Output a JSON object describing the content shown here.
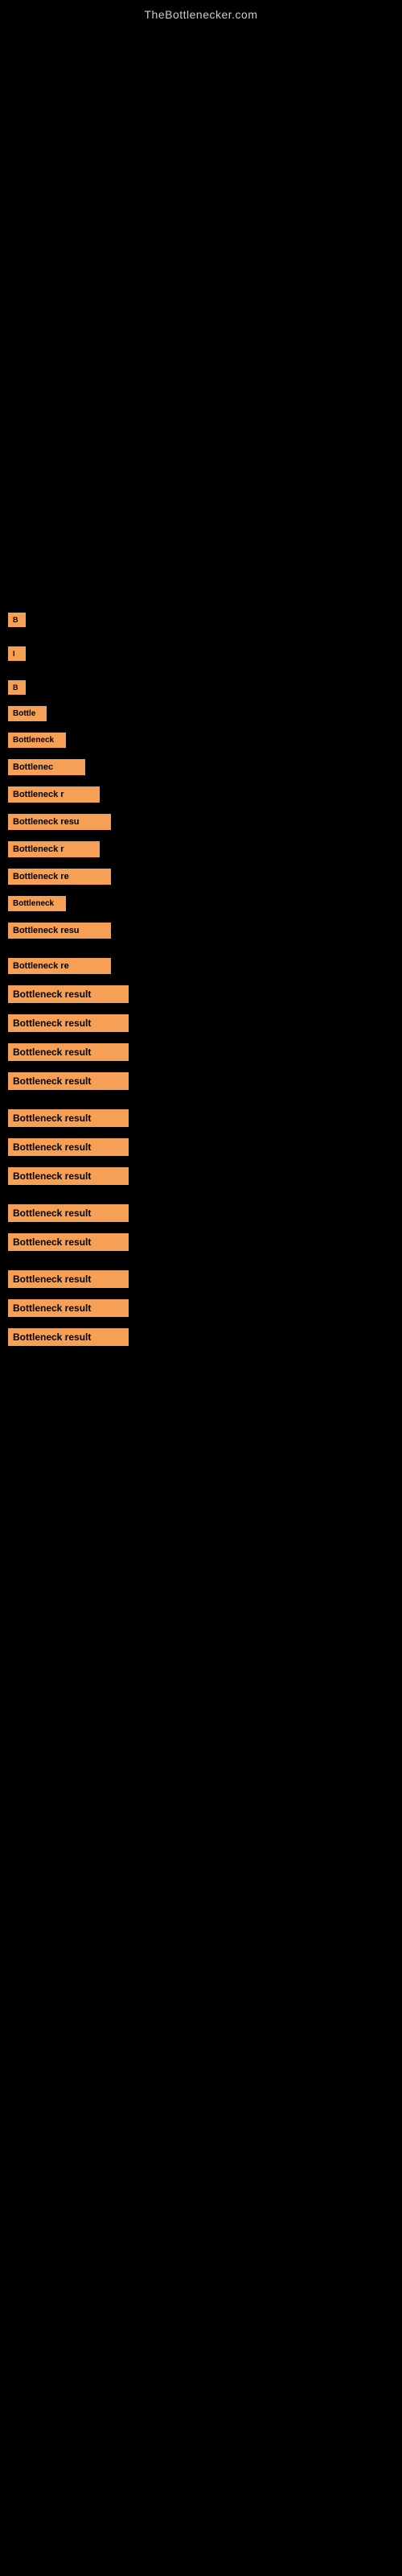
{
  "site": {
    "title": "TheBottlenecker.com"
  },
  "bottleneck_items": [
    {
      "id": 1,
      "label": "B",
      "size_class": "size-xs"
    },
    {
      "id": 2,
      "label": "I",
      "size_class": "size-xs"
    },
    {
      "id": 3,
      "label": "B",
      "size_class": "size-xs"
    },
    {
      "id": 4,
      "label": "Bottle",
      "size_class": "size-sm"
    },
    {
      "id": 5,
      "label": "Bottleneck",
      "size_class": "size-m"
    },
    {
      "id": 6,
      "label": "Bottlenec",
      "size_class": "size-ml"
    },
    {
      "id": 7,
      "label": "Bottleneck r",
      "size_class": "size-l"
    },
    {
      "id": 8,
      "label": "Bottleneck resu",
      "size_class": "size-xl"
    },
    {
      "id": 9,
      "label": "Bottleneck r",
      "size_class": "size-l"
    },
    {
      "id": 10,
      "label": "Bottleneck re",
      "size_class": "size-xl"
    },
    {
      "id": 11,
      "label": "Bottleneck",
      "size_class": "size-m"
    },
    {
      "id": 12,
      "label": "Bottleneck resu",
      "size_class": "size-xl"
    },
    {
      "id": 13,
      "label": "Bottleneck re",
      "size_class": "size-xl"
    },
    {
      "id": 14,
      "label": "Bottleneck result",
      "size_class": "size-xxl"
    },
    {
      "id": 15,
      "label": "Bottleneck result",
      "size_class": "size-xxl"
    },
    {
      "id": 16,
      "label": "Bottleneck result",
      "size_class": "size-xxl"
    },
    {
      "id": 17,
      "label": "Bottleneck result",
      "size_class": "size-xxl"
    },
    {
      "id": 18,
      "label": "Bottleneck result",
      "size_class": "size-xxl"
    },
    {
      "id": 19,
      "label": "Bottleneck result",
      "size_class": "size-xxl"
    },
    {
      "id": 20,
      "label": "Bottleneck result",
      "size_class": "size-xxl"
    },
    {
      "id": 21,
      "label": "Bottleneck result",
      "size_class": "size-xxl"
    },
    {
      "id": 22,
      "label": "Bottleneck result",
      "size_class": "size-xxl"
    },
    {
      "id": 23,
      "label": "Bottleneck result",
      "size_class": "size-xxl"
    },
    {
      "id": 24,
      "label": "Bottleneck result",
      "size_class": "size-xxl"
    },
    {
      "id": 25,
      "label": "Bottleneck result",
      "size_class": "size-xxl"
    }
  ]
}
